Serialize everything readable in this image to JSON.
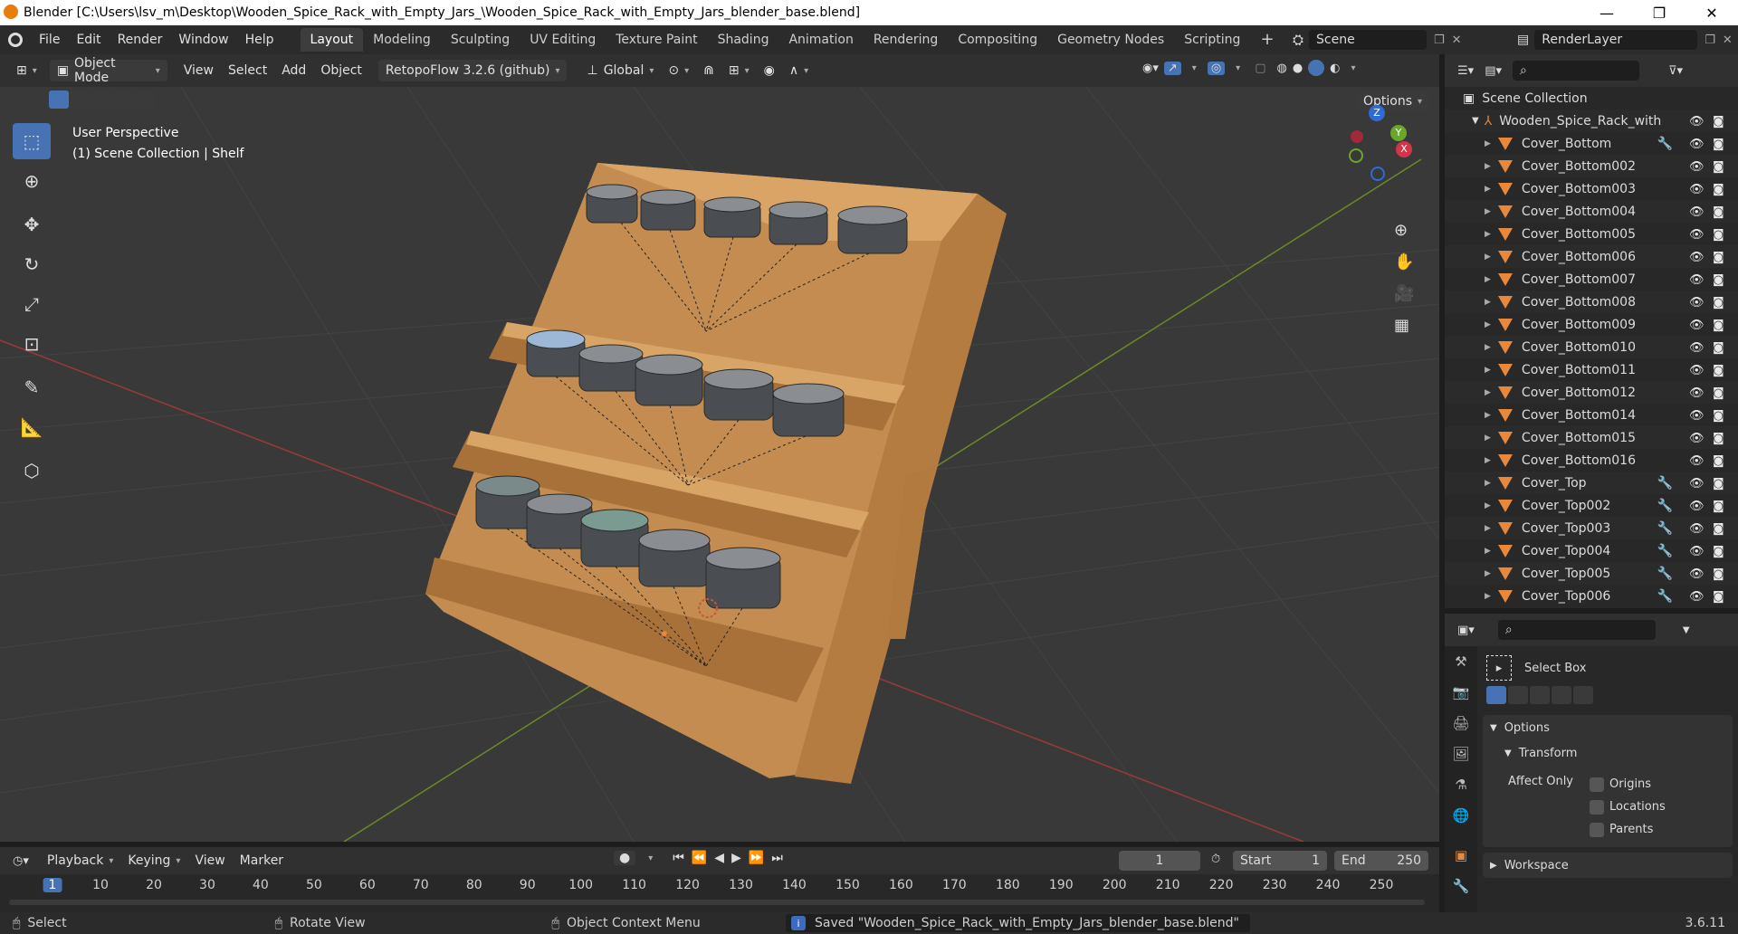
{
  "window": {
    "title": "Blender [C:\\Users\\lsv_m\\Desktop\\Wooden_Spice_Rack_with_Empty_Jars_\\Wooden_Spice_Rack_with_Empty_Jars_blender_base.blend]",
    "minimize": "—",
    "maximize": "❐",
    "close": "✕"
  },
  "menu": {
    "items": [
      "File",
      "Edit",
      "Render",
      "Window",
      "Help"
    ],
    "workspaces": [
      "Layout",
      "Modeling",
      "Sculpting",
      "UV Editing",
      "Texture Paint",
      "Shading",
      "Animation",
      "Rendering",
      "Compositing",
      "Geometry Nodes",
      "Scripting"
    ],
    "active_workspace": "Layout",
    "add_workspace": "+",
    "scene": "Scene",
    "view_layer": "RenderLayer"
  },
  "viewport_header": {
    "mode": "Object Mode",
    "menus": [
      "View",
      "Select",
      "Add",
      "Object"
    ],
    "addon": "RetopoFlow 3.2.6 (github)",
    "orientation": "Global",
    "options": "Options"
  },
  "viewport": {
    "perspective": "User Perspective",
    "context": "(1) Scene Collection | Shelf",
    "gizmo": {
      "x": "X",
      "y": "Y",
      "z": "Z"
    }
  },
  "outliner": {
    "root": "Scene Collection",
    "collection": "Wooden_Spice_Rack_with",
    "objects": [
      {
        "name": "Cover_Bottom",
        "modifier": true
      },
      {
        "name": "Cover_Bottom002",
        "modifier": false
      },
      {
        "name": "Cover_Bottom003",
        "modifier": false
      },
      {
        "name": "Cover_Bottom004",
        "modifier": false
      },
      {
        "name": "Cover_Bottom005",
        "modifier": false
      },
      {
        "name": "Cover_Bottom006",
        "modifier": false
      },
      {
        "name": "Cover_Bottom007",
        "modifier": false
      },
      {
        "name": "Cover_Bottom008",
        "modifier": false
      },
      {
        "name": "Cover_Bottom009",
        "modifier": false
      },
      {
        "name": "Cover_Bottom010",
        "modifier": false
      },
      {
        "name": "Cover_Bottom011",
        "modifier": false
      },
      {
        "name": "Cover_Bottom012",
        "modifier": false
      },
      {
        "name": "Cover_Bottom014",
        "modifier": false
      },
      {
        "name": "Cover_Bottom015",
        "modifier": false
      },
      {
        "name": "Cover_Bottom016",
        "modifier": false
      },
      {
        "name": "Cover_Top",
        "modifier": true
      },
      {
        "name": "Cover_Top002",
        "modifier": true
      },
      {
        "name": "Cover_Top003",
        "modifier": true
      },
      {
        "name": "Cover_Top004",
        "modifier": true
      },
      {
        "name": "Cover_Top005",
        "modifier": true
      },
      {
        "name": "Cover_Top006",
        "modifier": true
      }
    ]
  },
  "properties": {
    "tool_name": "Select Box",
    "options_label": "Options",
    "transform_label": "Transform",
    "affect_only": "Affect Only",
    "checkboxes": [
      "Origins",
      "Locations",
      "Parents"
    ],
    "workspace_label": "Workspace"
  },
  "timeline": {
    "menus": [
      "Playback",
      "Keying",
      "View",
      "Marker"
    ],
    "current_frame": "1",
    "start_label": "Start",
    "start": "1",
    "end_label": "End",
    "end": "250",
    "frame_labels": [
      "1",
      "10",
      "20",
      "30",
      "40",
      "50",
      "60",
      "70",
      "80",
      "90",
      "100",
      "110",
      "120",
      "130",
      "140",
      "150",
      "160",
      "170",
      "180",
      "190",
      "200",
      "210",
      "220",
      "230",
      "240",
      "250"
    ]
  },
  "statusbar": {
    "select": "Select",
    "rotate": "Rotate View",
    "context_menu": "Object Context Menu",
    "message": "Saved \"Wooden_Spice_Rack_with_Empty_Jars_blender_base.blend\"",
    "version": "3.6.11"
  },
  "colors": {
    "accent": "#4772b3",
    "object_orange": "#e7883d",
    "wood": "#c9955a"
  }
}
